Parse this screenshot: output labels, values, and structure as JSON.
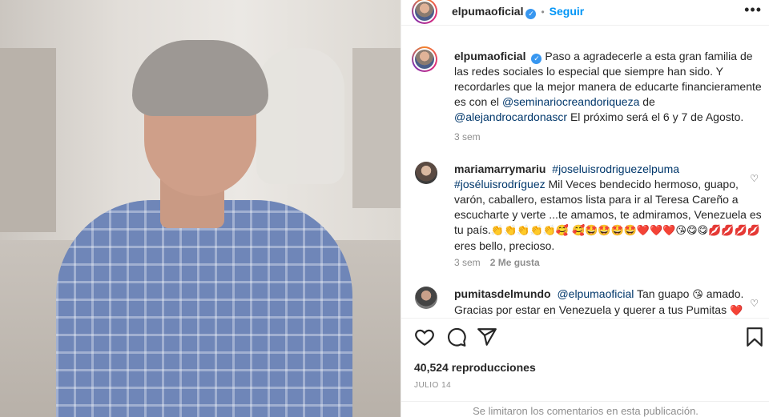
{
  "header": {
    "username": "elpumaoficial",
    "follow_label": "Seguir",
    "dot": "•",
    "more": "•••"
  },
  "caption": {
    "username": "elpumaoficial",
    "text_1": "Paso a agradecerle a esta gran familia de las redes sociales lo especial que siempre han sido. Y recordarles que la mejor manera de educarte financieramente es con el ",
    "mention_1": "@seminariocreandoriqueza",
    "text_2": " de ",
    "mention_2": "@alejandrocardonascr",
    "text_3": " El próximo será el 6 y 7 de Agosto.",
    "time": "3 sem"
  },
  "comments": [
    {
      "username": "mariamarrymariu",
      "hashtag_1": "#joseluisrodriguezelpuma",
      "hashtag_2": "#joséluisrodríguez",
      "text": " Mil Veces bendecido hermoso, guapo, varón, caballero, estamos lista para ir al Teresa Careño a escucharte y verte ...te amamos, te admiramos, Venezuela es tu país.",
      "emojis_1": "👏👏👏👏👏🥰",
      "emojis_2": "🥰🤩🤩🤩🤩❤️❤️❤️😘😋😋💋💋💋💋",
      "text_end": " eres bello, precioso.",
      "time": "3 sem",
      "likes": "2 Me gusta"
    },
    {
      "username": "pumitasdelmundo",
      "mention": "@elpumaoficial",
      "text": " Tan guapo ",
      "emoji": "😘",
      "text_2": " amado. Gracias por estar en Venezuela y querer a tus Pumitas ",
      "emoji_2": "❤️"
    }
  ],
  "stats": {
    "views": "40,524 reproducciones",
    "date": "JULIO 14"
  },
  "footer": {
    "closed_text": "Se limitaron los comentarios en esta publicación."
  },
  "icons": [
    "heart-icon",
    "comment-icon",
    "share-icon",
    "bookmark-icon",
    "verified-icon",
    "more-icon"
  ],
  "colors": {
    "link": "#00376b",
    "accent": "#0095f6",
    "verified": "#3897f0"
  }
}
